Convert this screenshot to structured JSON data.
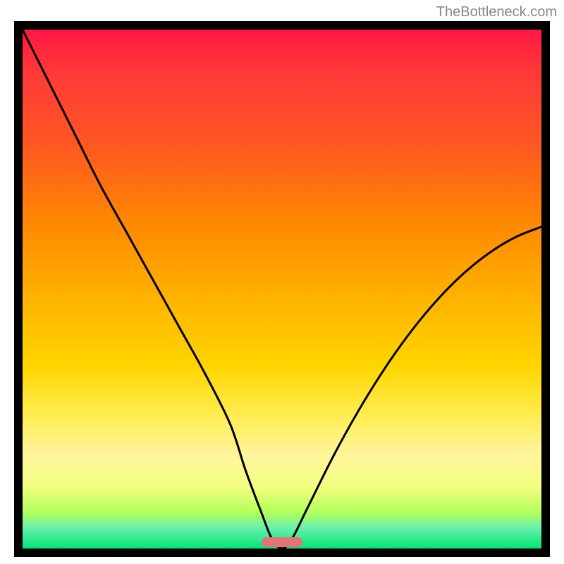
{
  "watermark": "TheBottleneck.com",
  "chart_data": {
    "type": "line",
    "title": "",
    "xlabel": "",
    "ylabel": "",
    "xlim": [
      0,
      100
    ],
    "ylim": [
      0,
      100
    ],
    "series": [
      {
        "name": "curve",
        "x": [
          0,
          5,
          10,
          15,
          20,
          25,
          30,
          35,
          40,
          43,
          46,
          48,
          50,
          52,
          55,
          60,
          65,
          70,
          75,
          80,
          85,
          90,
          95,
          100
        ],
        "y": [
          100,
          90,
          80,
          70,
          61,
          52,
          43,
          34,
          24,
          15,
          7,
          2,
          0,
          2,
          8,
          18,
          27,
          35,
          42,
          48,
          53,
          57,
          60,
          62
        ]
      }
    ],
    "marker": {
      "x_start": 46,
      "x_end": 54,
      "y": 0
    },
    "gradient_colors": {
      "top": "#ff1744",
      "bottom": "#00e676"
    }
  }
}
